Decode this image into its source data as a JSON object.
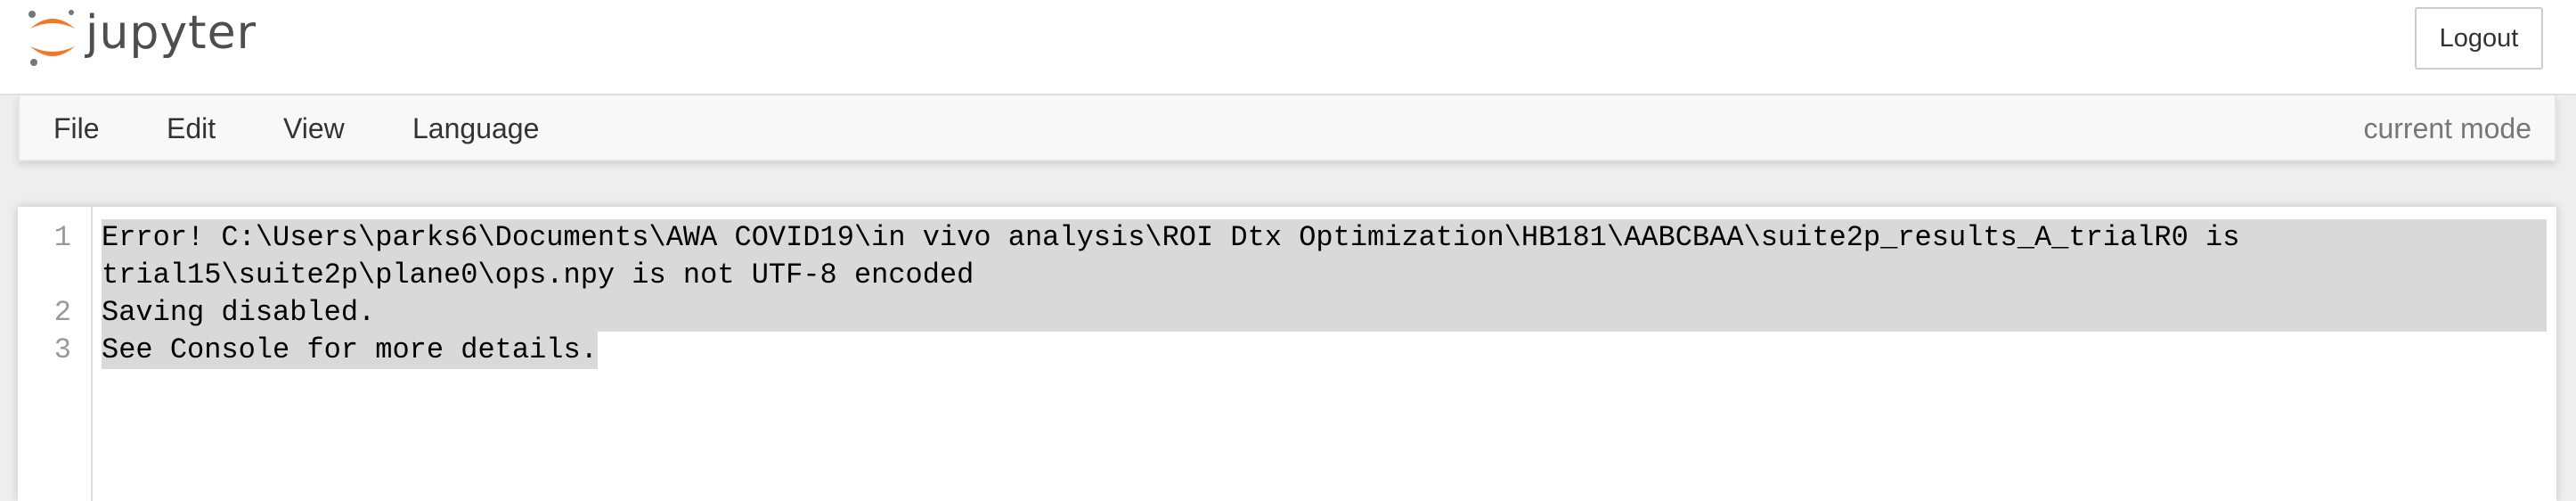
{
  "header": {
    "logo_text": "jupyter",
    "logout_label": "Logout"
  },
  "menu": {
    "items": [
      "File",
      "Edit",
      "View",
      "Language"
    ],
    "mode_label": "current mode"
  },
  "editor": {
    "line_numbers": [
      "1",
      "2",
      "3"
    ],
    "lines": [
      "Error! C:\\Users\\parks6\\Documents\\AWA COVID19\\in vivo analysis\\ROI Dtx Optimization\\HB181\\AABCBAA\\suite2p_results_A_trialR0 is",
      "trial15\\suite2p\\plane0\\ops.npy is not UTF-8 encoded",
      "Saving disabled.",
      "See Console for more details."
    ]
  },
  "colors": {
    "logo_orange": "#f37726",
    "logo_gray": "#767677",
    "selection": "#d9d9d9"
  }
}
